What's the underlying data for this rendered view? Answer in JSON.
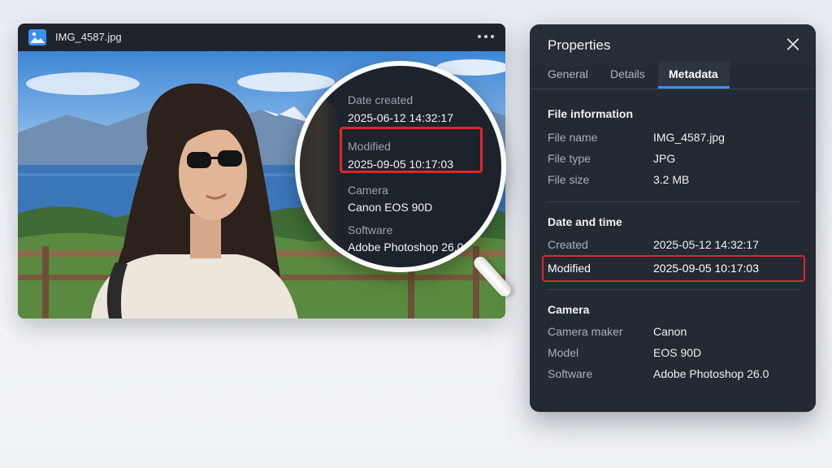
{
  "viewer": {
    "filename": "IMG_4587.jpg",
    "app_icon": "image-icon",
    "menu_icon": "more-options-icon"
  },
  "magnifier": {
    "rows": [
      {
        "label": "Date created",
        "value": "2025-06-12 14:32:17"
      },
      {
        "label": "Modified",
        "value": "2025-09-05 10:17:03"
      },
      {
        "label": "Camera",
        "value": "Canon EOS 90D"
      },
      {
        "label": "Software",
        "value": "Adobe Photoshop 26.0"
      }
    ]
  },
  "panel": {
    "title": "Properties",
    "tabs": [
      "General",
      "Details",
      "Metadata"
    ],
    "active_tab": "Metadata",
    "sections": {
      "file": {
        "title": "File information",
        "rows": [
          {
            "label": "File name",
            "value": "IMG_4587.jpg"
          },
          {
            "label": "File type",
            "value": "JPG"
          },
          {
            "label": "File size",
            "value": "3.2 MB"
          }
        ]
      },
      "datetime": {
        "title": "Date and time",
        "rows": [
          {
            "label": "Created",
            "value": "2025-05-12 14:32:17"
          },
          {
            "label": "Modified",
            "value": "2025-09-05 10:17:03"
          }
        ]
      },
      "camera": {
        "title": "Camera",
        "rows": [
          {
            "label": "Camera maker",
            "value": "Canon"
          },
          {
            "label": "Model",
            "value": "EOS 90D"
          },
          {
            "label": "Software",
            "value": "Adobe Photoshop 26.0"
          }
        ]
      }
    }
  },
  "colors": {
    "highlight": "#e0262b",
    "accent": "#3b8ff5",
    "panel_bg": "#232a33"
  }
}
